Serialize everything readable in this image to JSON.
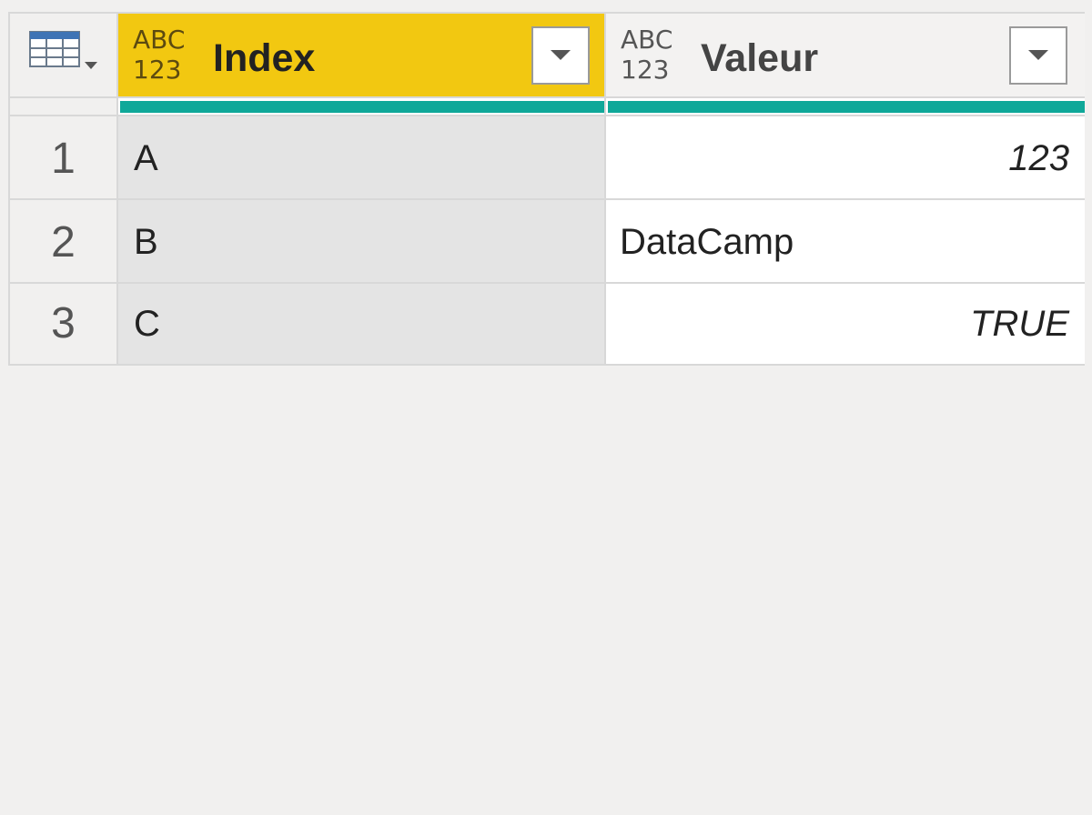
{
  "toolbar": {
    "table_menu_icon": "table-grid-icon"
  },
  "columns": [
    {
      "type_line1": "ABC",
      "type_line2": "123",
      "name": "Index",
      "selected": true
    },
    {
      "type_line1": "ABC",
      "type_line2": "123",
      "name": "Valeur",
      "selected": false
    }
  ],
  "rows": [
    {
      "num": "1",
      "index": "A",
      "valeur": "123"
    },
    {
      "num": "2",
      "index": "B",
      "valeur": "DataCamp"
    },
    {
      "num": "3",
      "index": "C",
      "valeur": "TRUE"
    }
  ],
  "colors": {
    "selected_header": "#f2c811",
    "quality_bar": "#0fa899",
    "selected_column_cells": "#e4e4e4"
  }
}
